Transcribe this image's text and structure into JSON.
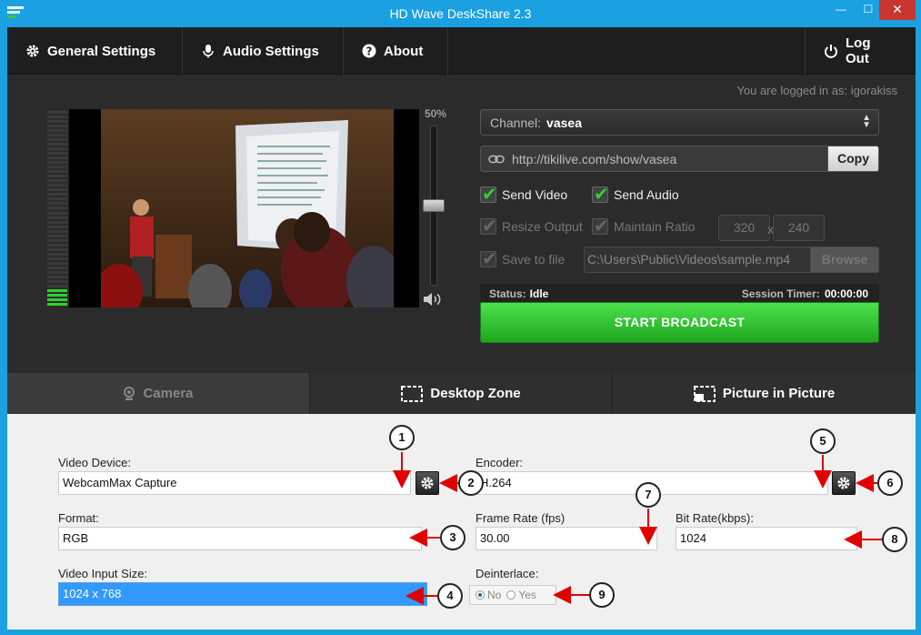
{
  "window": {
    "title": "HD Wave DeskShare 2.3",
    "min": "—",
    "max": "☐",
    "close": "✕"
  },
  "menu": {
    "general": "General Settings",
    "audio": "Audio Settings",
    "about": "About",
    "logout": "Log Out"
  },
  "account": {
    "logged_in_text": "You are logged in as:  igorakiss"
  },
  "volume": {
    "label": "50%",
    "level": 0.5
  },
  "channel": {
    "label": "Channel:",
    "value": "vasea"
  },
  "url": {
    "value": "http://tikilive.com/show/vasea",
    "copy_label": "Copy"
  },
  "options": {
    "send_video": "Send Video",
    "send_audio": "Send Audio",
    "resize_output": "Resize Output",
    "maintain_ratio": "Maintain Ratio",
    "width": "320",
    "height": "240",
    "x": "x",
    "save_to_file": "Save to file",
    "file_path": "C:\\Users\\Public\\Videos\\sample.mp4",
    "browse_label": "Browse"
  },
  "status": {
    "label": "Status:",
    "value": "Idle",
    "timer_label": "Session Timer:",
    "timer_value": "00:00:00"
  },
  "start_label": "START BROADCAST",
  "tabs": {
    "camera": "Camera",
    "desktop": "Desktop Zone",
    "pip": "Picture in Picture"
  },
  "camera_settings": {
    "video_device_label": "Video Device:",
    "video_device_value": "WebcamMax Capture",
    "encoder_label": "Encoder:",
    "encoder_value": "H.264",
    "format_label": "Format:",
    "format_value": "RGB",
    "frame_rate_label": "Frame Rate (fps)",
    "frame_rate_value": "30.00",
    "bit_rate_label": "Bit Rate(kbps):",
    "bit_rate_value": "1024",
    "input_size_label": "Video Input Size:",
    "input_size_value": "1024 x 768",
    "deinterlace_label": "Deinterlace:",
    "deinterlace_no": "No",
    "deinterlace_yes": "Yes",
    "deinterlace_selected": "No"
  },
  "callouts": [
    "1",
    "2",
    "3",
    "4",
    "5",
    "6",
    "7",
    "8",
    "9"
  ],
  "colors": {
    "accent": "#1ba1e2",
    "start_green": "#2ed12e",
    "close_red": "#c7372f",
    "arrow_red": "#e00000"
  }
}
